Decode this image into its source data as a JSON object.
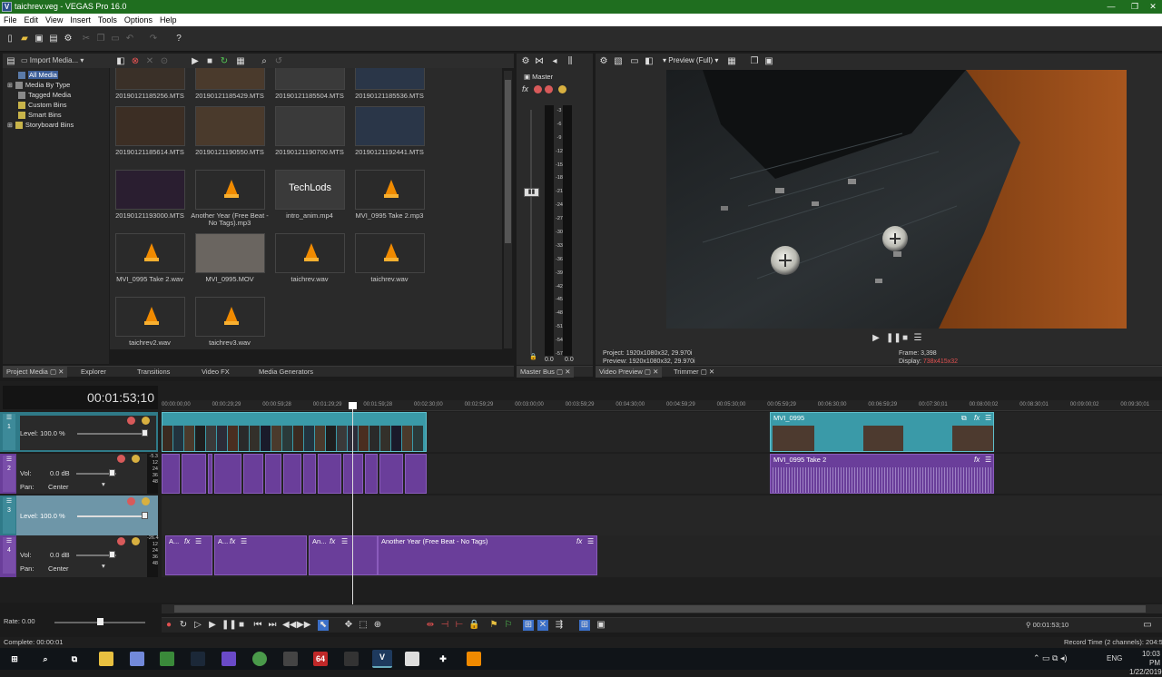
{
  "window": {
    "title": "taichrev.veg - VEGAS Pro 16.0",
    "app_icon_letter": "V",
    "minimize": "—",
    "maximize": "❐"
  },
  "menu": [
    "File",
    "Edit",
    "View",
    "Insert",
    "Tools",
    "Options",
    "Help"
  ],
  "media_toolbar": {
    "import_label": "Import Media..."
  },
  "tree": [
    {
      "label": "All Media"
    },
    {
      "label": "Media By Type"
    },
    {
      "label": "Tagged Media"
    },
    {
      "label": "Custom Bins"
    },
    {
      "label": "Smart Bins"
    },
    {
      "label": "Storyboard Bins"
    }
  ],
  "media_items": [
    {
      "name": "20190121185256.MTS",
      "kind": "video"
    },
    {
      "name": "20190121185429.MTS",
      "kind": "video"
    },
    {
      "name": "20190121185504.MTS",
      "kind": "video"
    },
    {
      "name": "20190121185536.MTS",
      "kind": "video"
    },
    {
      "name": "20190121185614.MTS",
      "kind": "video"
    },
    {
      "name": "20190121190550.MTS",
      "kind": "video"
    },
    {
      "name": "20190121190700.MTS",
      "kind": "video"
    },
    {
      "name": "20190121192441.MTS",
      "kind": "video"
    },
    {
      "name": "20190121193000.MTS",
      "kind": "video"
    },
    {
      "name": "Another Year (Free Beat - No Tags).mp3",
      "kind": "audio"
    },
    {
      "name": "intro_anim.mp4",
      "kind": "logo"
    },
    {
      "name": "MVI_0995 Take 2.mp3",
      "kind": "audio"
    },
    {
      "name": "MVI_0995 Take 2.wav",
      "kind": "audio"
    },
    {
      "name": "MVI_0995.MOV",
      "kind": "person"
    },
    {
      "name": "taichrev.wav",
      "kind": "audio"
    },
    {
      "name": "taichrev.wav",
      "kind": "audio"
    },
    {
      "name": "taichrev2.wav",
      "kind": "audio"
    },
    {
      "name": "taichrev3.wav",
      "kind": "audio"
    }
  ],
  "intro_logo_text": "TechLods",
  "left_tabs": [
    "Project Media",
    "Explorer",
    "Transitions",
    "Video FX",
    "Media Generators"
  ],
  "master": {
    "label": "Master",
    "tab": "Master Bus",
    "scale": [
      "3",
      "6",
      "9",
      "12",
      "15",
      "18",
      "21",
      "24",
      "27",
      "30",
      "33",
      "36",
      "39",
      "42",
      "45",
      "48",
      "51",
      "54",
      "57"
    ],
    "readout_left": "0.0",
    "readout_right": "0.0"
  },
  "preview": {
    "quality": "Preview (Full)",
    "project_label": "Project:",
    "project_value": "1920x1080x32, 29.970i",
    "preview_label": "Preview:",
    "preview_value": "1920x1080x32, 29.970i",
    "frame_label": "Frame:",
    "frame_value": "3,398",
    "display_label": "Display:",
    "display_value": "738x415x32",
    "tabs": [
      "Video Preview",
      "Trimmer"
    ]
  },
  "timeline": {
    "timecode": "00:01:53;10",
    "ruler": [
      "00:00:00;00",
      "00:00:29;29",
      "00:00:59;28",
      "00:01:29;29",
      "00:01:59;28",
      "00:02:30;00",
      "00:02:59;29",
      "00:03:00;00",
      "00:03:59;29",
      "00:04:30;00",
      "00:04:59;29",
      "00:05:30;00",
      "00:05:59;29",
      "00:06:30;00",
      "00:06:59;29",
      "00:07:30;01",
      "00:08:00;02",
      "00:08:30;01",
      "00:09:00;02",
      "00:09:30;01"
    ],
    "tracks": [
      {
        "num": "1",
        "type": "video",
        "level": "Level: 100.0 %"
      },
      {
        "num": "2",
        "type": "audio",
        "vol_label": "Vol:",
        "vol": "0.0 dB",
        "pan_label": "Pan:",
        "pan": "Center",
        "peak": "-5.3"
      },
      {
        "num": "3",
        "type": "video",
        "level": "Level: 100.0 %"
      },
      {
        "num": "4",
        "type": "audio",
        "vol_label": "Vol:",
        "vol": "0.0 dB",
        "pan_label": "Pan:",
        "pan": "Center",
        "peak": "-26.4"
      }
    ],
    "db_scale": [
      "12",
      "24",
      "36",
      "48"
    ],
    "clip_mvi": "MVI_0995",
    "clip_mvi_take2": "MVI_0995 Take 2",
    "clip_another_year": "Another Year (Free Beat - No Tags)",
    "clip_a1": "A...",
    "clip_a2": "A...",
    "clip_an": "An...",
    "rate_label": "Rate: 0.00",
    "end_time": "00:01:53;10"
  },
  "status": {
    "left": "Complete: 00:00:01",
    "right": "Record Time (2 channels): 204:5"
  },
  "taskbar": {
    "lang": "ENG",
    "time": "10:03 PM",
    "date": "1/22/2019",
    "badge": "64"
  },
  "colors": {
    "titlebar": "#1f6e1f",
    "video_clip": "#3a9aa8",
    "audio_clip": "#6a3e9a",
    "display_value": "#e05050"
  }
}
